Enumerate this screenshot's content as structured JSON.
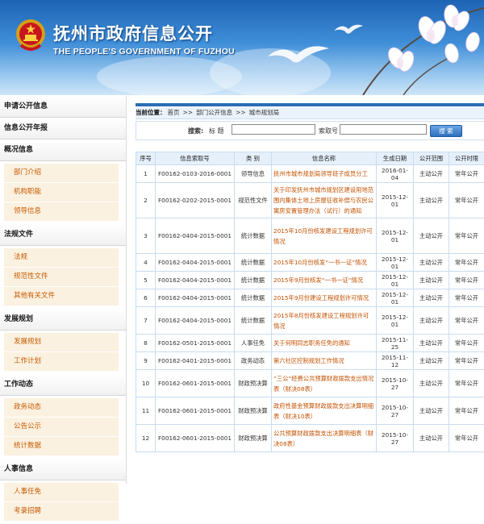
{
  "header": {
    "title_cn": "抚州市政府信息公开",
    "title_en": "THE PEOPLE'S GOVERNMENT OF FUZHOU"
  },
  "sidebar": {
    "sections": [
      {
        "title": "申请公开信息",
        "items": []
      },
      {
        "title": "信息公开年报",
        "items": []
      },
      {
        "title": "概况信息",
        "items": [
          "部门介绍",
          "机构职能",
          "领导信息"
        ]
      },
      {
        "title": "法规文件",
        "items": [
          "法规",
          "规范性文件",
          "其他有关文件"
        ]
      },
      {
        "title": "发展规划",
        "items": [
          "发展规划",
          "工作计划"
        ]
      },
      {
        "title": "工作动态",
        "items": [
          "政务动态",
          "公告公示",
          "统计数据"
        ]
      },
      {
        "title": "人事信息",
        "items": [
          "人事任免",
          "考录招聘"
        ]
      }
    ]
  },
  "breadcrumb": {
    "label": "当前位置：",
    "items": [
      "首页",
      "部门公开信息",
      "城市规划局"
    ],
    "separator": ">>"
  },
  "search": {
    "label": "搜索:",
    "title_label": "标 题",
    "index_label": "索取号",
    "title_value": "",
    "index_value": "",
    "button": "搜 索"
  },
  "table": {
    "headers": [
      "序号",
      "信息索取号",
      "类 别",
      "信息名称",
      "生成日期",
      "公开范围",
      "公开时限"
    ],
    "rows": [
      {
        "no": "1",
        "code": "F00162-0103-2016-0001",
        "category": "领导信息",
        "name": "抚州市城市规划局领导班子成员分工",
        "date": "2016-01-04",
        "scope": "主动公开",
        "term": "常年公开"
      },
      {
        "no": "2",
        "code": "F00162-0202-2015-0001",
        "category": "规范性文件",
        "name": "关于印发抚州市城市规划区建设用地范围内集体土地上房屋征收补偿与农民公寓房安置管理办法（试行）的通知",
        "date": "2015-12-01",
        "scope": "主动公开",
        "term": "常年公开"
      },
      {
        "no": "3",
        "code": "F00162-0404-2015-0001",
        "category": "统计数据",
        "name": "2015年10月份核发建设工程规划许可情况",
        "date": "2015-12-01",
        "scope": "主动公开",
        "term": "常年公开"
      },
      {
        "no": "4",
        "code": "F00162-0404-2015-0001",
        "category": "统计数据",
        "name": "2015年10月份核发“一书一证”情况",
        "date": "2015-12-01",
        "scope": "主动公开",
        "term": "常年公开"
      },
      {
        "no": "5",
        "code": "F00162-0404-2015-0001",
        "category": "统计数据",
        "name": "2015年9月份核发“一书一证”情况",
        "date": "2015-12-01",
        "scope": "主动公开",
        "term": "常年公开"
      },
      {
        "no": "6",
        "code": "F00162-0404-2015-0001",
        "category": "统计数据",
        "name": "2015年9月份建设工程规划许可情况",
        "date": "2015-12-01",
        "scope": "主动公开",
        "term": "常年公开"
      },
      {
        "no": "7",
        "code": "F00162-0404-2015-0001",
        "category": "统计数据",
        "name": "2015年8月份核发建设工程规划许可情况",
        "date": "2015-12-01",
        "scope": "主动公开",
        "term": "常年公开"
      },
      {
        "no": "8",
        "code": "F00162-0501-2015-0001",
        "category": "人事任免",
        "name": "关于何明同志职务任免的通知",
        "date": "2015-11-25",
        "scope": "主动公开",
        "term": "常年公开"
      },
      {
        "no": "9",
        "code": "F00162-0401-2015-0001",
        "category": "政务动态",
        "name": "第六社区控制规划工作情况",
        "date": "2015-11-12",
        "scope": "主动公开",
        "term": "常年公开"
      },
      {
        "no": "10",
        "code": "F00162-0601-2015-0001",
        "category": "财政预决算",
        "name": "“三公”经费公共预算财政拨款支出情况表（财决08表）",
        "date": "2015-10-27",
        "scope": "主动公开",
        "term": "常年公开"
      },
      {
        "no": "11",
        "code": "F00162-0601-2015-0001",
        "category": "财政预决算",
        "name": "政府性基金预算财政拨款支出决算明细表（财决10表）",
        "date": "2015-10-27",
        "scope": "主动公开",
        "term": "常年公开"
      },
      {
        "no": "12",
        "code": "F00162-0601-2015-0001",
        "category": "财政预决算",
        "name": "公共预算财政拨款支出决算明细表（财决08表）",
        "date": "2015-10-27",
        "scope": "主动公开",
        "term": "常年公开"
      }
    ]
  }
}
